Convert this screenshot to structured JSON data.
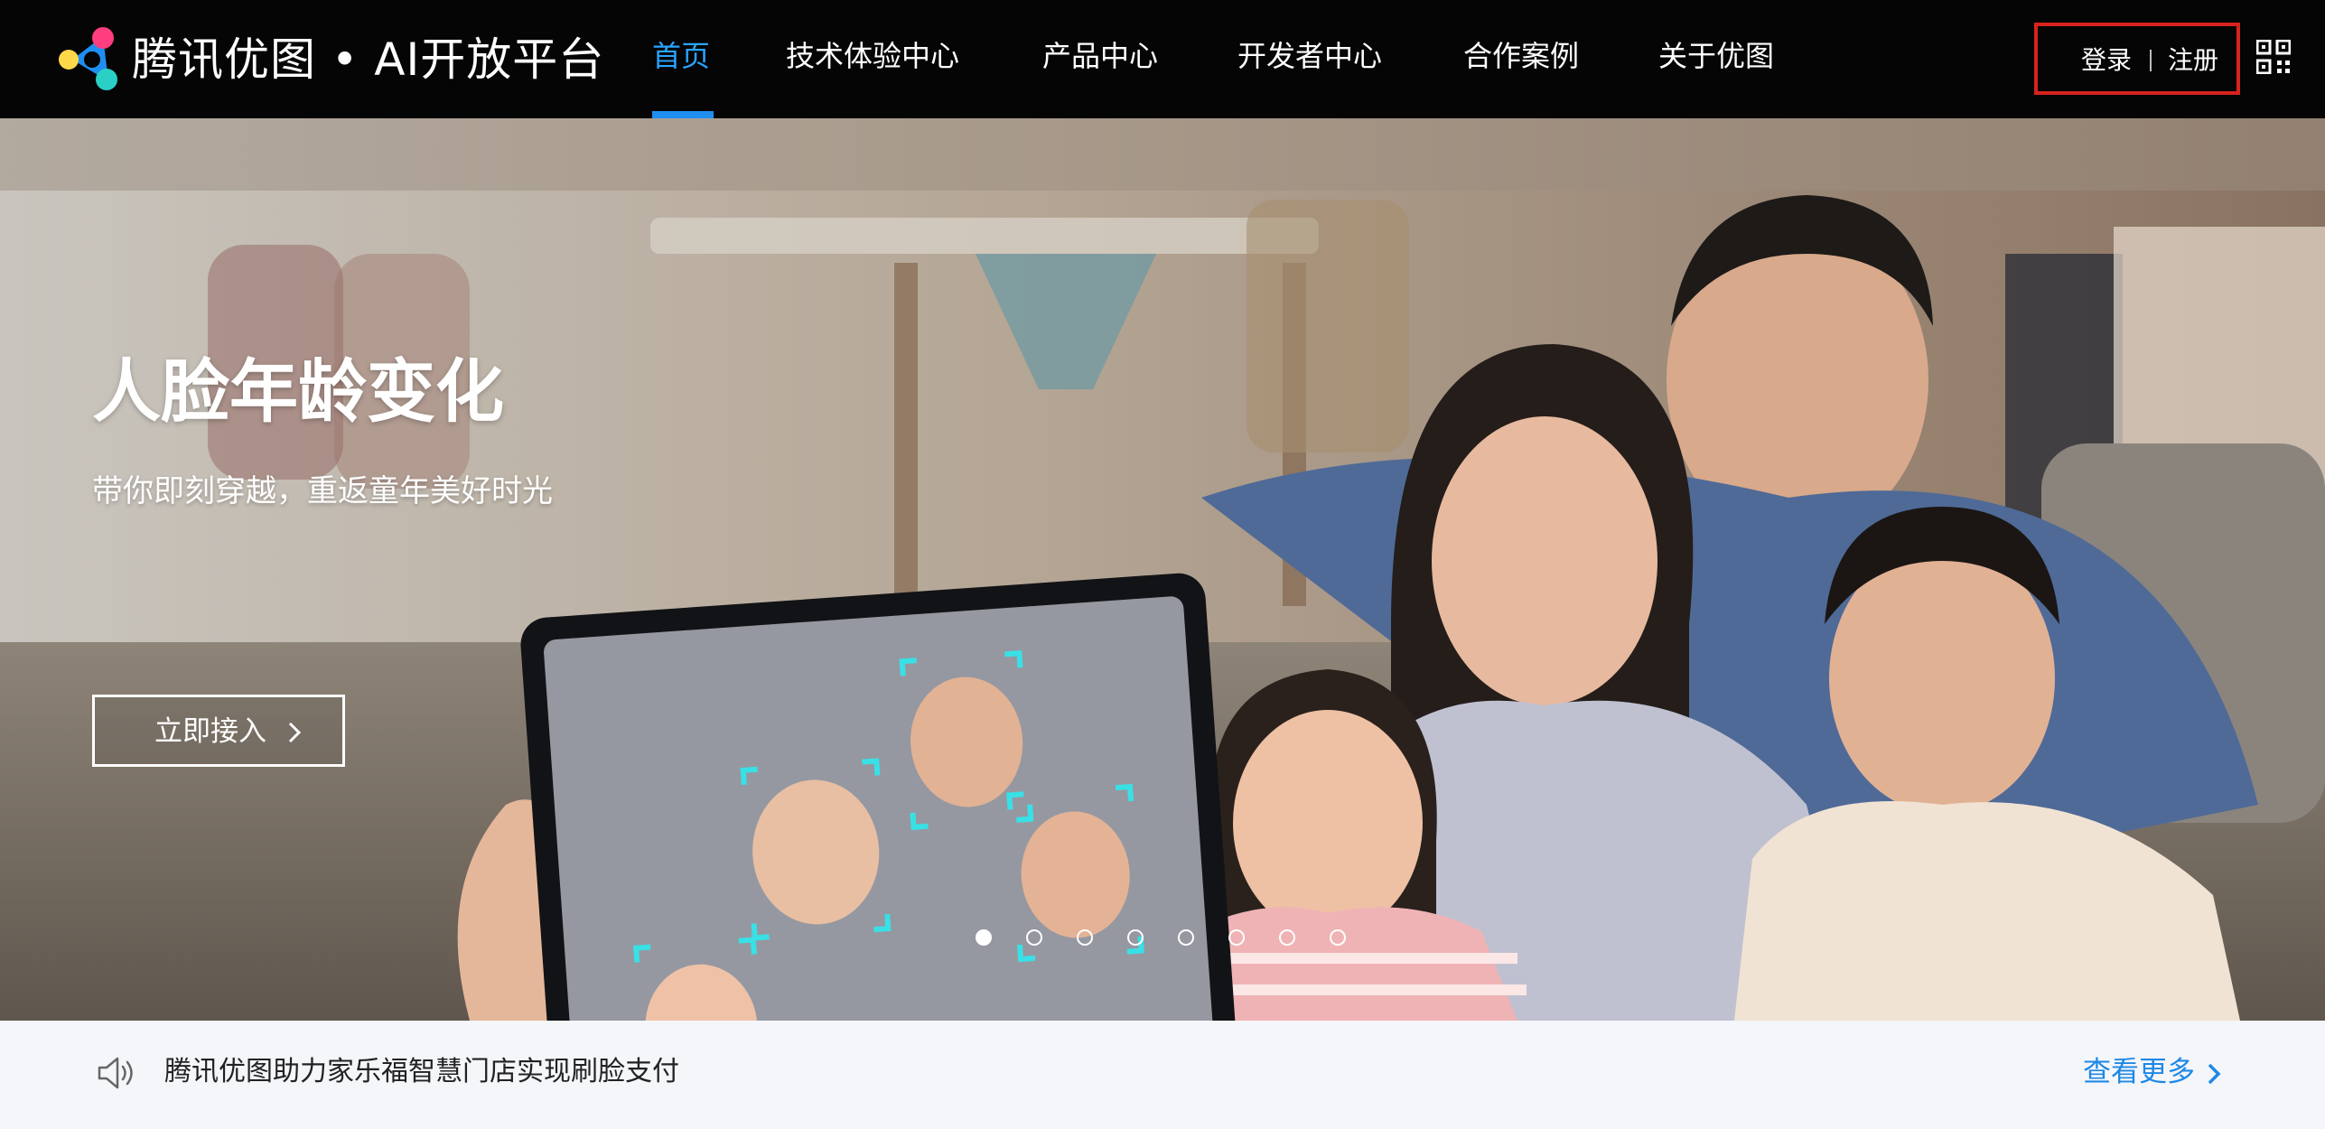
{
  "brand": {
    "name": "腾讯优图 • AI开放平台",
    "logo_colors": [
      "#ff3d7f",
      "#2ad0c6",
      "#1f8ef1",
      "#ffd84a"
    ]
  },
  "nav": {
    "items": [
      {
        "label": "首页",
        "active": true
      },
      {
        "label": "技术体验中心",
        "active": false
      },
      {
        "label": "产品中心",
        "active": false
      },
      {
        "label": "开发者中心",
        "active": false
      },
      {
        "label": "合作案例",
        "active": false
      },
      {
        "label": "关于优图",
        "active": false
      }
    ],
    "active_color": "#1f8ef1"
  },
  "auth": {
    "login_label": "登录",
    "separator": "|",
    "register_label": "注册",
    "highlight_color": "#d8231d"
  },
  "icons": {
    "qr": "qr-code-icon",
    "speaker": "speaker-icon",
    "chevron": "chevron-right-icon"
  },
  "banner": {
    "title": "人脸年龄变化",
    "subtitle": "带你即刻穿越，重返童年美好时光",
    "cta_label": "立即接入",
    "carousel": {
      "total": 8,
      "active_index": 0
    }
  },
  "news": {
    "text": "腾讯优图助力家乐福智慧门店实现刷脸支付",
    "more_label": "查看更多",
    "link_color": "#1e88e5"
  }
}
